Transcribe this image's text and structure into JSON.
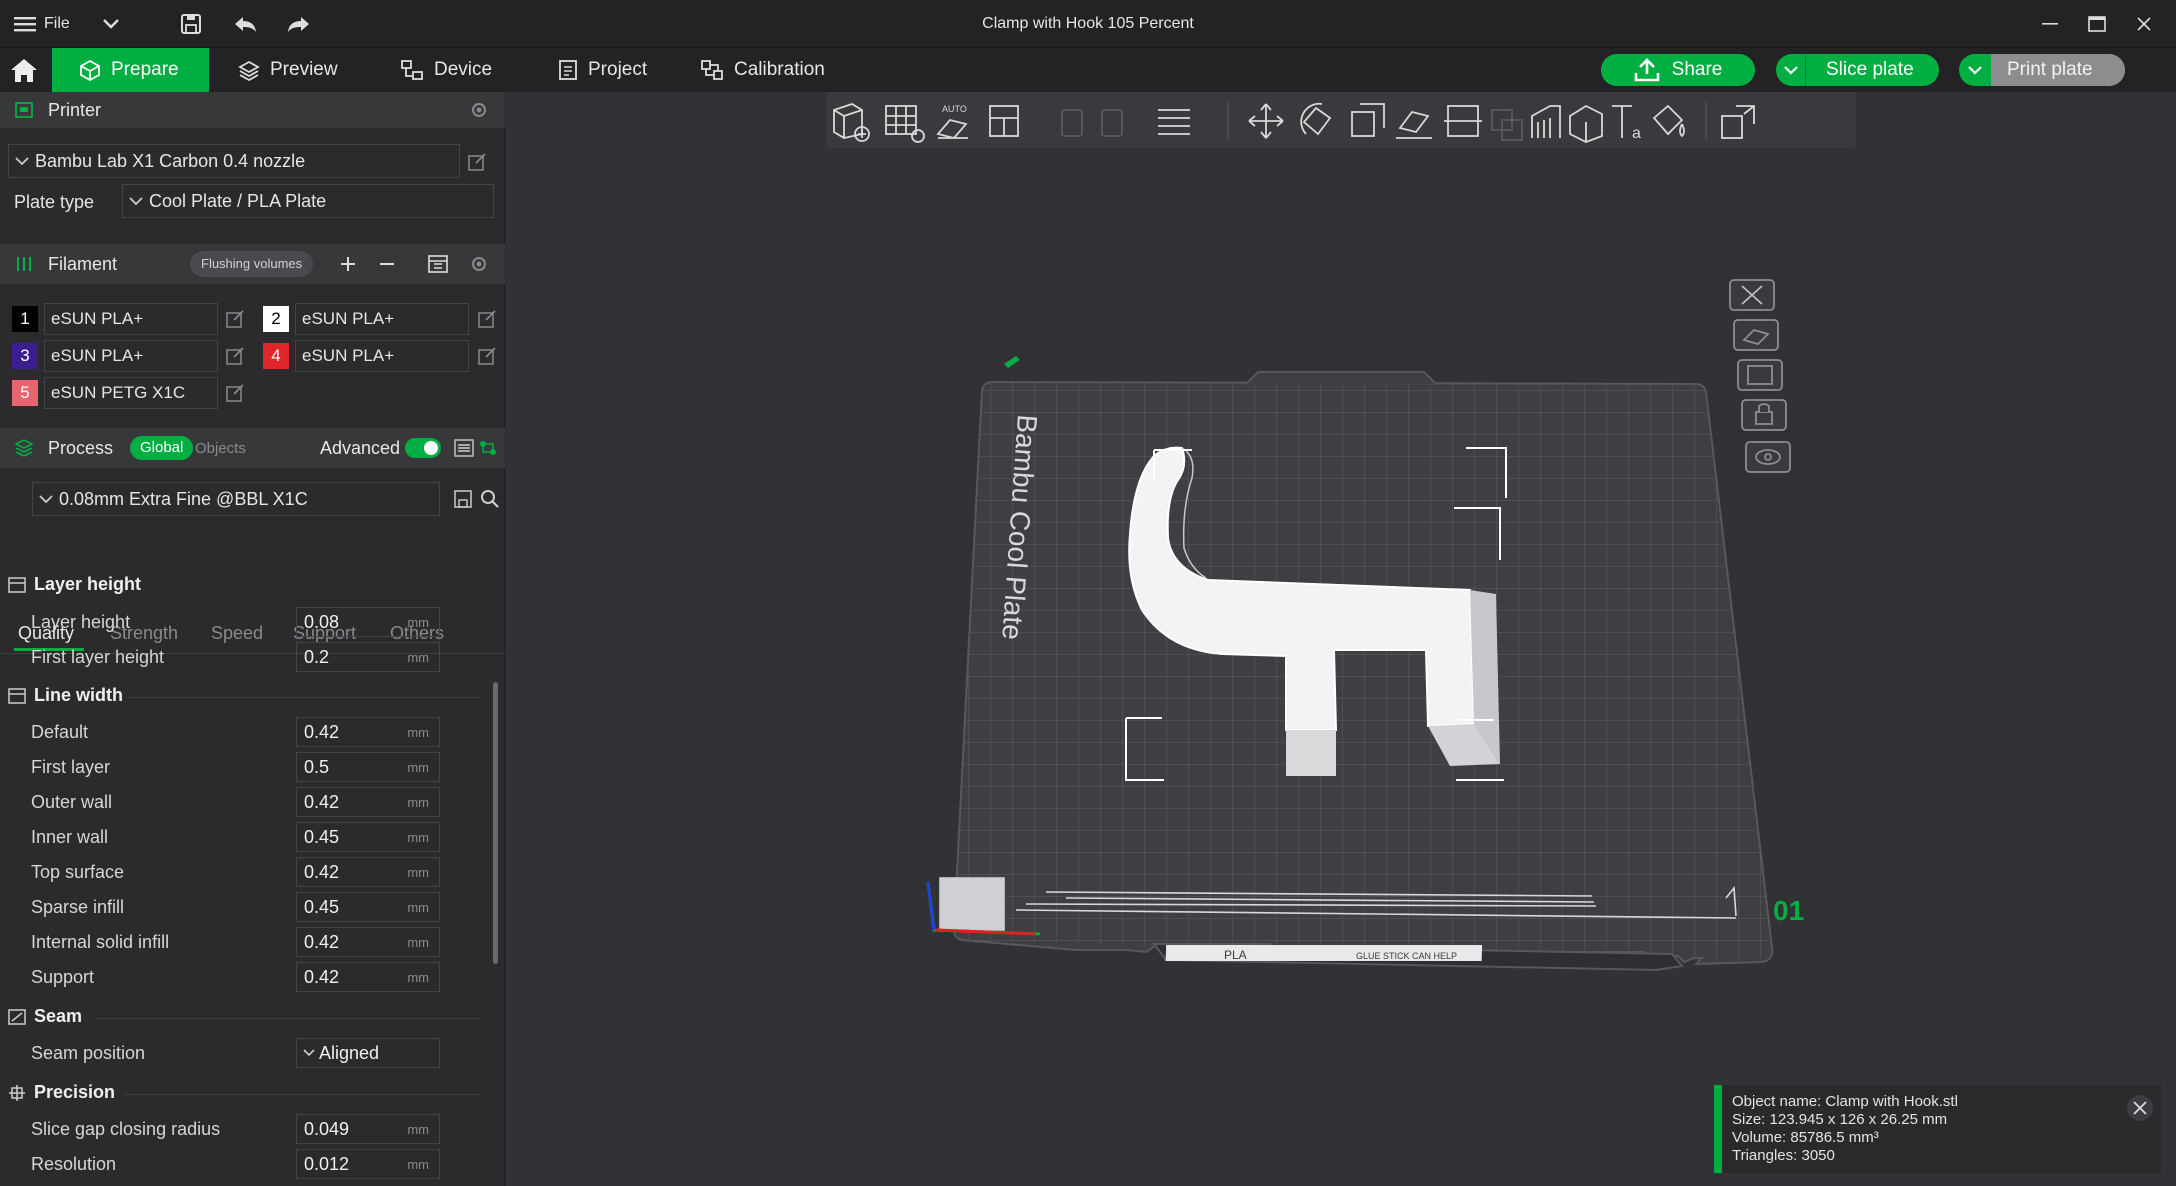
{
  "window": {
    "title": "Clamp with Hook 105 Percent",
    "file_label": "File"
  },
  "tabs": {
    "prepare": "Prepare",
    "preview": "Preview",
    "device": "Device",
    "project": "Project",
    "calibration": "Calibration"
  },
  "actions": {
    "share": "Share",
    "slice": "Slice plate",
    "print": "Print plate"
  },
  "printer": {
    "header": "Printer",
    "name": "Bambu Lab X1 Carbon 0.4 nozzle",
    "plate_type_label": "Plate type",
    "plate_type": "Cool Plate / PLA Plate"
  },
  "filament": {
    "header": "Filament",
    "flushing": "Flushing volumes",
    "items": [
      {
        "num": "1",
        "name": "eSUN PLA+",
        "color": "#000000",
        "text": "#ffffff"
      },
      {
        "num": "2",
        "name": "eSUN PLA+",
        "color": "#ffffff",
        "text": "#000000"
      },
      {
        "num": "3",
        "name": "eSUN PLA+",
        "color": "#3b1f8f",
        "text": "#ffffff"
      },
      {
        "num": "4",
        "name": "eSUN PLA+",
        "color": "#e0262a",
        "text": "#ffffff"
      },
      {
        "num": "5",
        "name": "eSUN PETG X1C",
        "color": "#e8646e",
        "text": "#ffffff"
      }
    ]
  },
  "process": {
    "header": "Process",
    "global": "Global",
    "objects": "Objects",
    "advanced": "Advanced",
    "preset": "0.08mm Extra Fine @BBL X1C",
    "tabs": [
      "Quality",
      "Strength",
      "Speed",
      "Support",
      "Others"
    ]
  },
  "settings": {
    "layer_height": {
      "title": "Layer height",
      "layer_height_label": "Layer height",
      "layer_height": "0.08",
      "first_layer_height_label": "First layer height",
      "first_layer_height": "0.2"
    },
    "line_width": {
      "title": "Line width",
      "default_label": "Default",
      "default": "0.42",
      "first_layer_label": "First layer",
      "first_layer": "0.5",
      "outer_wall_label": "Outer wall",
      "outer_wall": "0.42",
      "inner_wall_label": "Inner wall",
      "inner_wall": "0.45",
      "top_surface_label": "Top surface",
      "top_surface": "0.42",
      "sparse_infill_label": "Sparse infill",
      "sparse_infill": "0.45",
      "internal_solid_infill_label": "Internal solid infill",
      "internal_solid_infill": "0.42",
      "support_label": "Support",
      "support": "0.42"
    },
    "seam": {
      "title": "Seam",
      "position_label": "Seam position",
      "position": "Aligned"
    },
    "precision": {
      "title": "Precision",
      "slice_gap_label": "Slice gap closing radius",
      "slice_gap": "0.049",
      "resolution_label": "Resolution",
      "resolution": "0.012"
    },
    "unit": "mm"
  },
  "plate": {
    "label": "Bambu Cool Plate",
    "number": "01",
    "strip_text": "PLA",
    "glue_text": "GLUE STICK CAN HELP"
  },
  "object_info": {
    "name": "Object name: Clamp with Hook.stl",
    "size": "Size: 123.945 x 126 x 26.25 mm",
    "volume": "Volume: 85786.5 mm³",
    "triangles": "Triangles: 3050"
  },
  "colors": {
    "accent": "#00ae42"
  }
}
